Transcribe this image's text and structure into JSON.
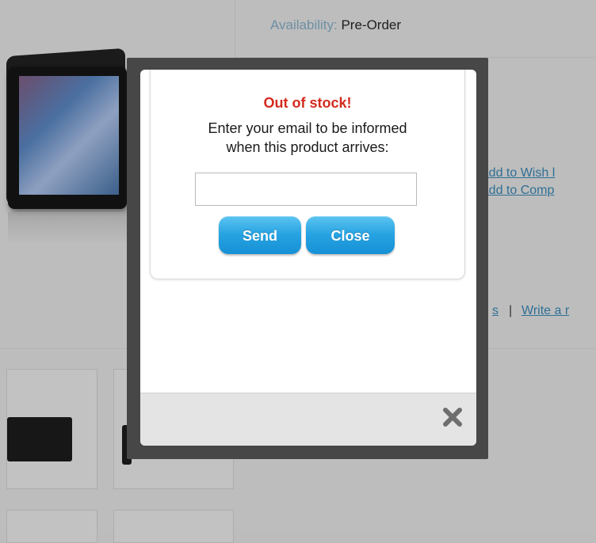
{
  "background": {
    "availability_label": "Availability:",
    "availability_value": "Pre-Order",
    "wishlist_link": "Add to Wish l",
    "compare_link": "Add to Comp",
    "reviews_link_fragment": "s",
    "separator": "|",
    "write_review_link": "Write a r"
  },
  "modal": {
    "title": "Out of stock!",
    "message_line1": "Enter your email to be informed",
    "message_line2": "when this product arrives:",
    "email_value": "",
    "send_label": "Send",
    "close_label": "Close",
    "close_icon": "close-x-icon"
  },
  "colors": {
    "title_red": "#d42a1f",
    "button_blue": "#27a3e2",
    "overlay_frame": "#474747"
  }
}
